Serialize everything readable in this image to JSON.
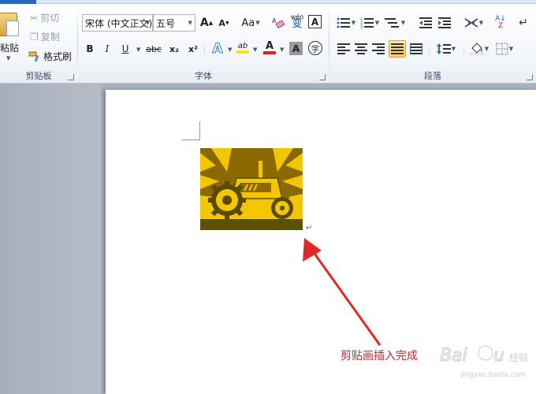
{
  "ribbon": {
    "clipboard": {
      "label": "剪贴板",
      "paste": "粘贴",
      "cut": "剪切",
      "copy": "复制",
      "format_painter": "格式刷"
    },
    "font": {
      "label": "字体",
      "font_name": "宋体 (中文正文)",
      "font_size": "五号",
      "grow": "A",
      "shrink": "A",
      "change_case": "Aa",
      "phonetic": "wén",
      "phonetic_char": "变",
      "border_char": "A",
      "bold": "B",
      "italic": "I",
      "underline": "U",
      "strike": "abc",
      "subscript": "x₂",
      "superscript": "x²",
      "text_effect": "A",
      "highlight": "ab",
      "font_color": "A",
      "shading": "A",
      "enclose": "字"
    },
    "paragraph": {
      "label": "段落"
    }
  },
  "document": {
    "annotation": "剪贴画插入完成",
    "watermark": "Baidu 经验",
    "watermark_url": "jingyan.baidu.com"
  },
  "colors": {
    "accent": "#2b64b8",
    "annotation": "#c0282b",
    "highlight_yellow": "#f9e21b",
    "font_red": "#e02020"
  }
}
